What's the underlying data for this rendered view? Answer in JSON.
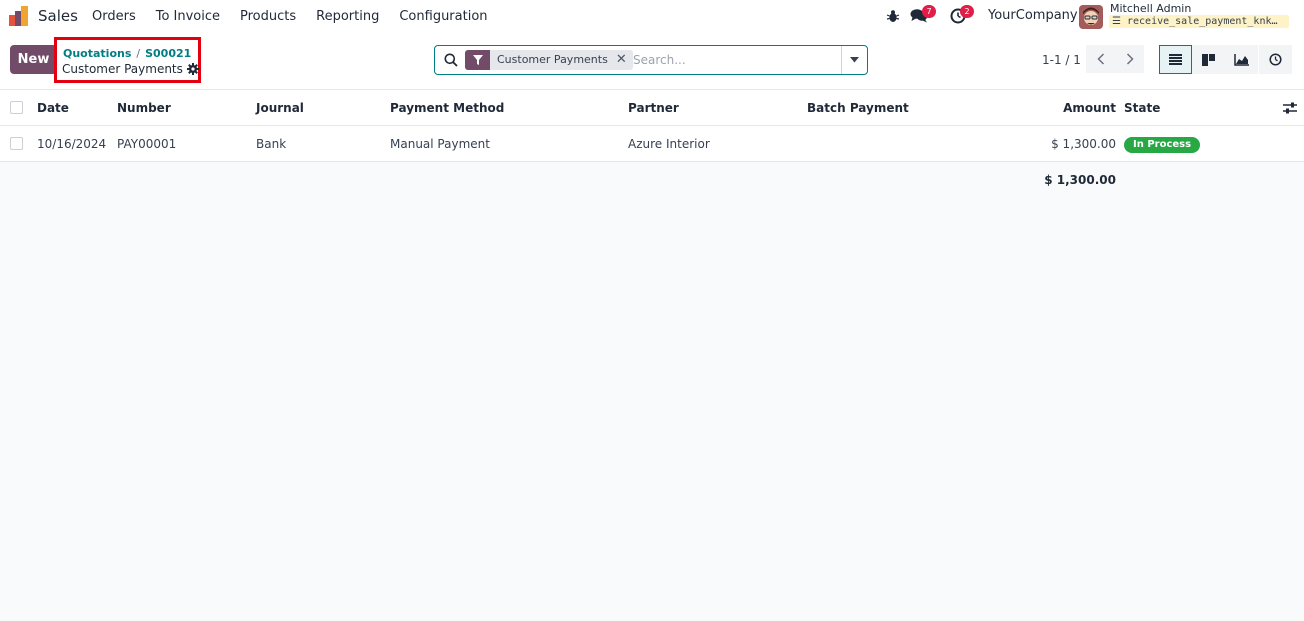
{
  "navbar": {
    "app_name": "Sales",
    "menu": [
      "Orders",
      "To Invoice",
      "Products",
      "Reporting",
      "Configuration"
    ],
    "messages_count": "7",
    "activities_count": "2",
    "company": "YourCompany",
    "user_name": "Mitchell Admin",
    "database": "receive_sale_payment_knk…"
  },
  "control_panel": {
    "new_label": "New",
    "breadcrumb": [
      "Quotations",
      "S00021"
    ],
    "breadcrumb_separator": "/",
    "current_page": "Customer Payments",
    "search": {
      "facet": "Customer Payments",
      "facet_remove": "✕",
      "placeholder": "Search..."
    },
    "pager": "1-1 / 1"
  },
  "list": {
    "columns": [
      "Date",
      "Number",
      "Journal",
      "Payment Method",
      "Partner",
      "Batch Payment",
      "Amount",
      "State"
    ],
    "rows": [
      {
        "date": "10/16/2024",
        "number": "PAY00001",
        "journal": "Bank",
        "payment_method": "Manual Payment",
        "partner": "Azure Interior",
        "batch_payment": "",
        "amount": "$ 1,300.00",
        "state": "In Process"
      }
    ],
    "total_amount": "$ 1,300.00"
  },
  "colors": {
    "brand": "#714b67",
    "accent": "#017e84",
    "highlight_box": "#e3000f",
    "state_in_process": "#28a745",
    "badge": "#e11d48"
  }
}
